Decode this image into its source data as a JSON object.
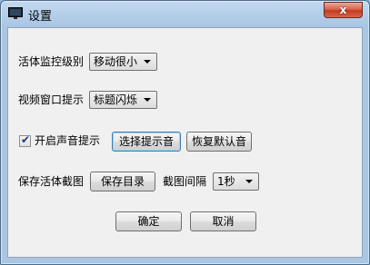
{
  "window": {
    "title": "设置",
    "close_glyph": "x"
  },
  "activity": {
    "label": "活体监控级别",
    "selected": "移动很小"
  },
  "video": {
    "label": "视频窗口提示",
    "selected": "标题闪烁"
  },
  "sound": {
    "checkbox_label": "开启声音提示",
    "checked": true,
    "choose_button": "选择提示音",
    "restore_button": "恢复默认音"
  },
  "save": {
    "label": "保存活体截图",
    "dir_button": "保存目录",
    "interval_label": "截图间隔",
    "interval_selected": "1秒"
  },
  "footer": {
    "ok_button": "确定",
    "cancel_button": "取消"
  },
  "icons": {
    "app": "monitor-icon",
    "close": "close-icon",
    "dropdown": "chevron-down-icon",
    "check": "check-icon"
  }
}
